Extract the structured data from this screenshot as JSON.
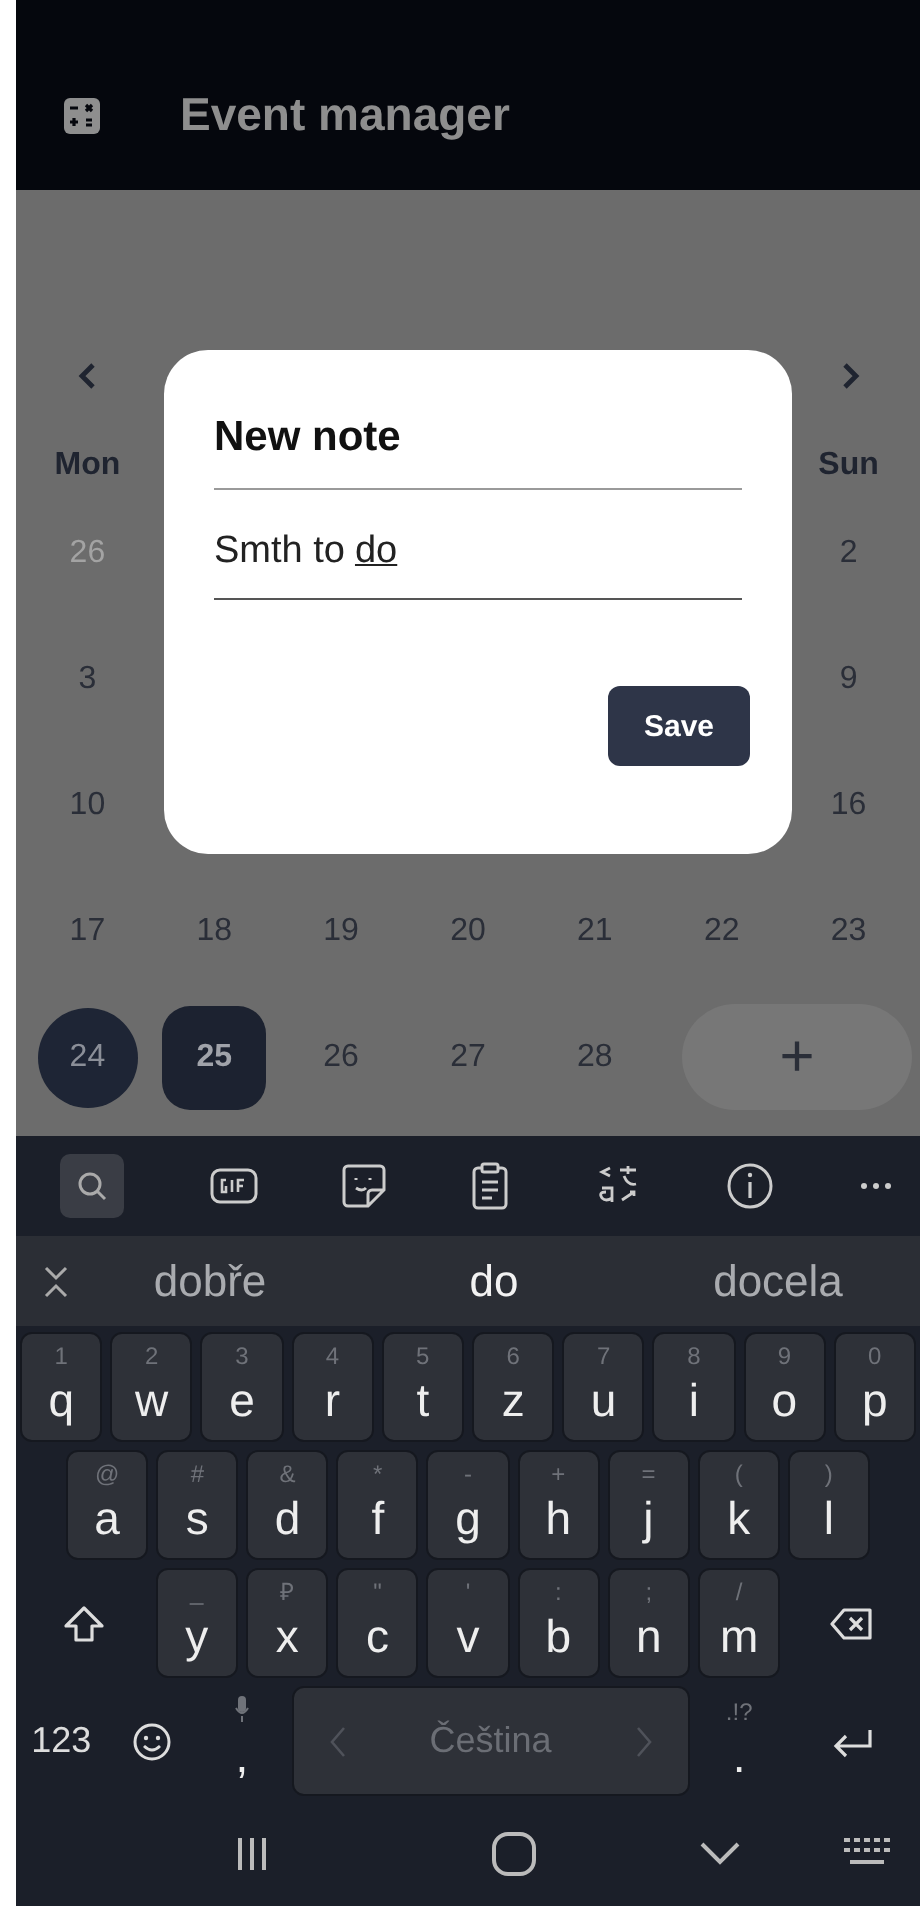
{
  "app_bar": {
    "title": "Event manager"
  },
  "calendar": {
    "header": {
      "left": "Mon",
      "right": "Sun"
    },
    "partial_rows": [
      {
        "left": {
          "day": "26",
          "muted": true
        },
        "right": {
          "day": "2",
          "muted": false
        }
      },
      {
        "left": {
          "day": "3",
          "muted": false
        },
        "right": {
          "day": "9",
          "muted": false
        }
      },
      {
        "left": {
          "day": "10",
          "muted": false
        },
        "right": {
          "day": "16",
          "muted": false
        }
      }
    ],
    "full_rows": [
      [
        {
          "day": "17",
          "kind": "plain"
        },
        {
          "day": "18",
          "kind": "plain"
        },
        {
          "day": "19",
          "kind": "plain"
        },
        {
          "day": "20",
          "kind": "plain"
        },
        {
          "day": "21",
          "kind": "plain"
        },
        {
          "day": "22",
          "kind": "plain"
        },
        {
          "day": "23",
          "kind": "plain"
        }
      ],
      [
        {
          "day": "24",
          "kind": "circle"
        },
        {
          "day": "25",
          "kind": "square"
        },
        {
          "day": "26",
          "kind": "plain"
        },
        {
          "day": "27",
          "kind": "plain"
        },
        {
          "day": "28",
          "kind": "plain"
        }
      ]
    ],
    "add_button": "+"
  },
  "dialog": {
    "title": "New note",
    "value_parts": [
      {
        "text": "Smth to",
        "composing": false
      },
      {
        "text": "do",
        "composing": true
      }
    ],
    "save_button": "Save"
  },
  "keyboard": {
    "suggestions": [
      {
        "text": "dobře",
        "selected": false
      },
      {
        "text": "do",
        "selected": true
      },
      {
        "text": "docela",
        "selected": false
      }
    ],
    "rows": [
      [
        {
          "kind": "char",
          "label": "q",
          "hint": "1"
        },
        {
          "kind": "char",
          "label": "w",
          "hint": "2"
        },
        {
          "kind": "char",
          "label": "e",
          "hint": "3"
        },
        {
          "kind": "char",
          "label": "r",
          "hint": "4"
        },
        {
          "kind": "char",
          "label": "t",
          "hint": "5"
        },
        {
          "kind": "char",
          "label": "z",
          "hint": "6"
        },
        {
          "kind": "char",
          "label": "u",
          "hint": "7"
        },
        {
          "kind": "char",
          "label": "i",
          "hint": "8"
        },
        {
          "kind": "char",
          "label": "o",
          "hint": "9"
        },
        {
          "kind": "char",
          "label": "p",
          "hint": "0"
        }
      ],
      [
        {
          "kind": "char",
          "label": "a",
          "hint": "@"
        },
        {
          "kind": "char",
          "label": "s",
          "hint": "#"
        },
        {
          "kind": "char",
          "label": "d",
          "hint": "&"
        },
        {
          "kind": "char",
          "label": "f",
          "hint": "*"
        },
        {
          "kind": "char",
          "label": "g",
          "hint": "-"
        },
        {
          "kind": "char",
          "label": "h",
          "hint": "+"
        },
        {
          "kind": "char",
          "label": "j",
          "hint": "="
        },
        {
          "kind": "char",
          "label": "k",
          "hint": "("
        },
        {
          "kind": "char",
          "label": "l",
          "hint": ")"
        }
      ],
      [
        {
          "kind": "shift"
        },
        {
          "kind": "char",
          "label": "y",
          "hint": "_"
        },
        {
          "kind": "char",
          "label": "x",
          "hint": "₽"
        },
        {
          "kind": "char",
          "label": "c",
          "hint": "\""
        },
        {
          "kind": "char",
          "label": "v",
          "hint": "'"
        },
        {
          "kind": "char",
          "label": "b",
          "hint": ":"
        },
        {
          "kind": "char",
          "label": "n",
          "hint": ";"
        },
        {
          "kind": "char",
          "label": "m",
          "hint": "/"
        },
        {
          "kind": "backspace"
        }
      ]
    ],
    "bottom_row": [
      {
        "kind": "mode",
        "label": "123"
      },
      {
        "kind": "emoji"
      },
      {
        "kind": "voice",
        "label": ","
      },
      {
        "kind": "space",
        "label": "Čeština"
      },
      {
        "kind": "flat",
        "label": ".",
        "hint": ".!?"
      },
      {
        "kind": "enter"
      }
    ]
  }
}
